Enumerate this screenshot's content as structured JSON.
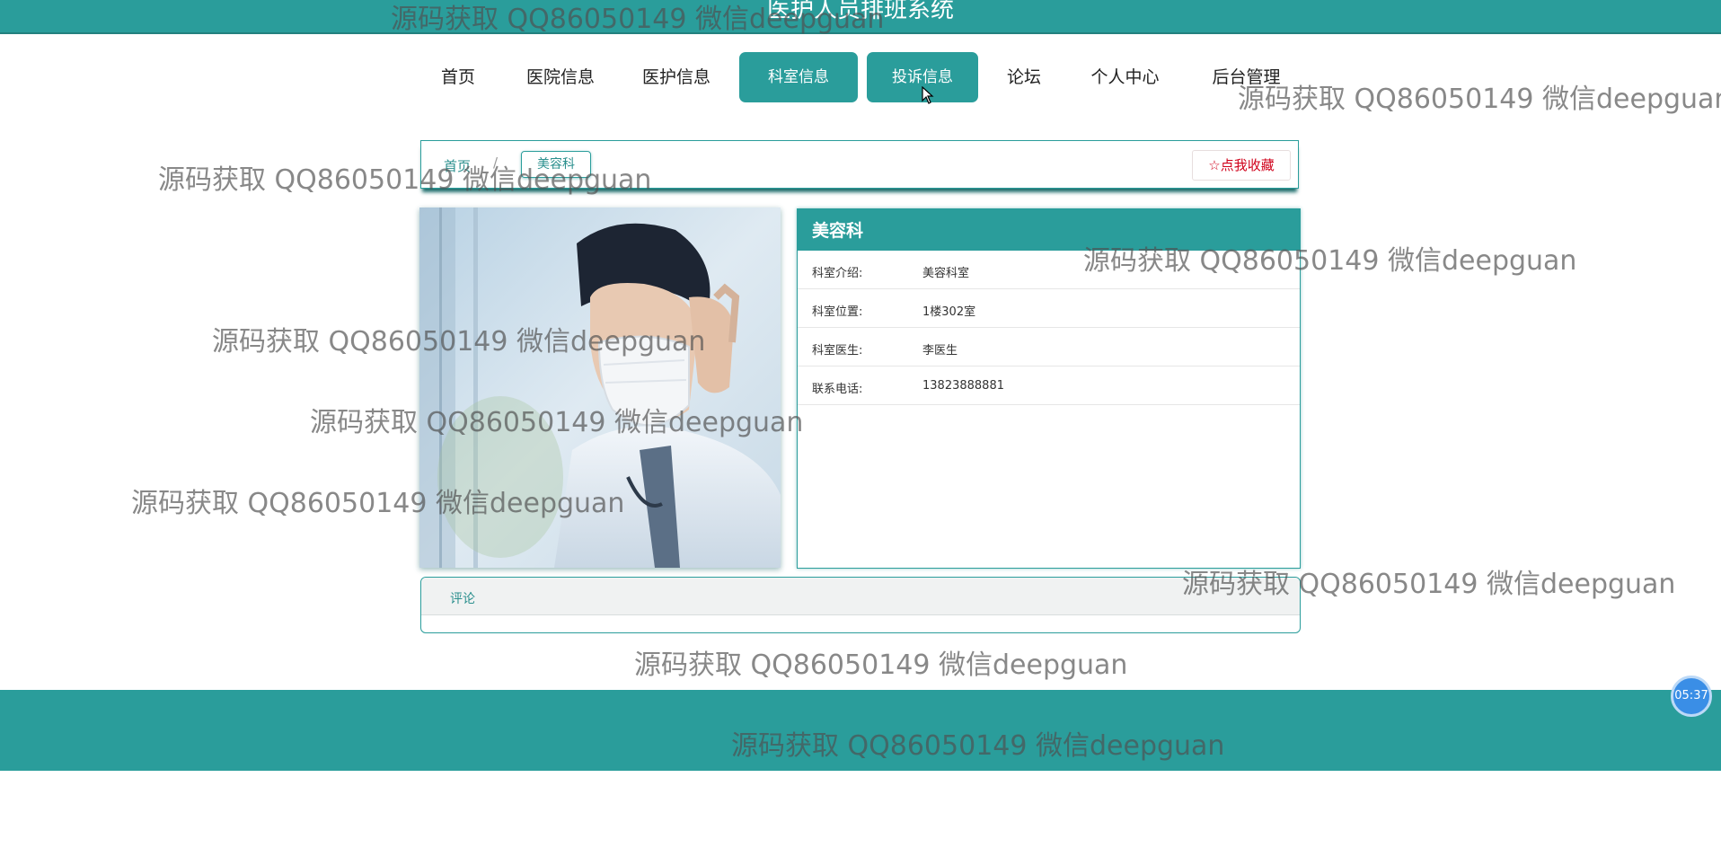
{
  "header": {
    "title": "医护人员排班系统"
  },
  "nav": {
    "items": [
      {
        "label": "首页"
      },
      {
        "label": "医院信息"
      },
      {
        "label": "医护信息"
      },
      {
        "label": "科室信息"
      },
      {
        "label": "投诉信息"
      },
      {
        "label": "论坛"
      },
      {
        "label": "个人中心"
      },
      {
        "label": "后台管理"
      }
    ],
    "active": [
      "科室信息",
      "投诉信息"
    ]
  },
  "breadcrumb": {
    "home": "首页",
    "separator": "/",
    "current": "美容科",
    "favorite_label": "点我收藏"
  },
  "department": {
    "name": "美容科",
    "fields": [
      {
        "label": "科室介绍:",
        "value": "美容科室"
      },
      {
        "label": "科室位置:",
        "value": "1楼302室"
      },
      {
        "label": "科室医生:",
        "value": "李医生"
      },
      {
        "label": "联系电话:",
        "value": "13823888881"
      }
    ]
  },
  "comments": {
    "tab_label": "评论"
  },
  "timer": {
    "text": "05:37"
  },
  "watermark": {
    "text": "源码获取 QQ86050149 微信deepguan"
  },
  "colors": {
    "primary": "#2a9d9b",
    "favorite": "#d0021b",
    "timer": "#3a8ee6"
  },
  "icons": {
    "favorite": "star-outline-icon",
    "cursor": "mouse-pointer-icon"
  }
}
